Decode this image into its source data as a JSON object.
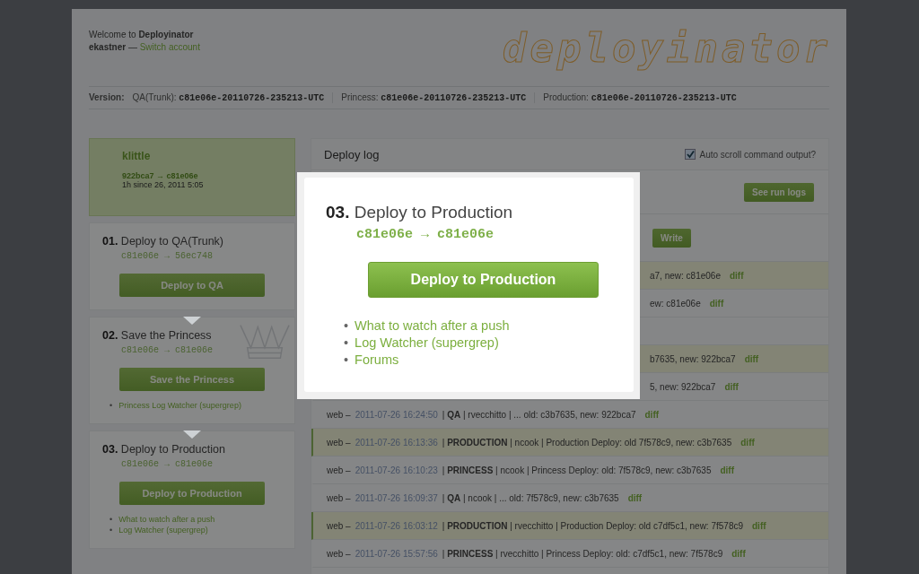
{
  "header": {
    "welcome_prefix": "Welcome to ",
    "app_name": "Deployinator",
    "user": "ekastner",
    "separator": " — ",
    "switch_link": "Switch account",
    "logo": "deployinator"
  },
  "versions": {
    "label": "Version:",
    "items": [
      {
        "env": "QA(Trunk):",
        "value": "c81e06e-20110726-235213-UTC"
      },
      {
        "env": "Princess:",
        "value": "c81e06e-20110726-235213-UTC"
      },
      {
        "env": "Production:",
        "value": "c81e06e-20110726-235213-UTC"
      }
    ]
  },
  "current_deploy": {
    "user": "klittle",
    "revs": "922bca7 → c81e06e",
    "since": "1h since 26, 2011 5:05"
  },
  "steps": [
    {
      "number": "01.",
      "title": "Deploy to QA(Trunk)",
      "revs": "c81e06e → 56ec748",
      "button": "Deploy to QA"
    },
    {
      "number": "02.",
      "title": "Save the Princess",
      "revs": "c81e06e → c81e06e",
      "button": "Save the Princess",
      "links": [
        {
          "bullet": "•",
          "text": "Princess Log Watcher (supergrep)"
        }
      ]
    },
    {
      "number": "03.",
      "title": "Deploy to Production",
      "revs": "c81e06e → c81e06e",
      "button": "Deploy to Production",
      "links": [
        {
          "bullet": "•",
          "text": "What to watch after a push"
        },
        {
          "bullet": "•",
          "text": "Log Watcher (supergrep)"
        }
      ]
    }
  ],
  "log": {
    "title": "Deploy log",
    "auto_scroll": {
      "label": "Auto scroll command output?",
      "checked": true
    },
    "run_logs_button": "See run logs",
    "write_button": "Write",
    "rows": [
      {
        "kind": "covered",
        "tail": "a7, new: c81e06e",
        "diff": "diff",
        "highlighted": true
      },
      {
        "kind": "covered",
        "tail": "ew: c81e06e",
        "diff": "diff",
        "highlighted": false
      },
      {
        "kind": "covered",
        "highlighted": false
      },
      {
        "kind": "covered",
        "tail": "b7635, new: 922bca7",
        "diff": "diff",
        "highlighted": true
      },
      {
        "kind": "covered",
        "tail": "5, new: 922bca7",
        "diff": "diff",
        "highlighted": false
      },
      {
        "kind": "entry",
        "source": "web –",
        "time": "2011-07-26 16:24:50",
        "text": "| **QA** | rvecchitto | ... old: c3b7635, new: 922bca7",
        "diff": "diff",
        "highlighted": false
      },
      {
        "kind": "entry",
        "source": "web –",
        "time": "2011-07-26 16:13:36",
        "text": "| **PRODUCTION** | ncook | Production Deploy: old 7f578c9, new: c3b7635",
        "diff": "diff",
        "highlighted": true
      },
      {
        "kind": "entry",
        "source": "web –",
        "time": "2011-07-26 16:10:23",
        "text": "| **PRINCESS** | ncook | Princess Deploy: old: 7f578c9, new: c3b7635",
        "diff": "diff",
        "highlighted": false
      },
      {
        "kind": "entry",
        "source": "web –",
        "time": "2011-07-26 16:09:37",
        "text": "| **QA** | ncook | ... old: 7f578c9, new: c3b7635",
        "diff": "diff",
        "highlighted": false
      },
      {
        "kind": "entry",
        "source": "web –",
        "time": "2011-07-26 16:03:12",
        "text": "| **PRODUCTION** | rvecchitto | Production Deploy: old c7df5c1, new: 7f578c9",
        "diff": "diff",
        "highlighted": true
      },
      {
        "kind": "entry",
        "source": "web –",
        "time": "2011-07-26 15:57:56",
        "text": "| **PRINCESS** | rvecchitto | Princess Deploy: old: c7df5c1, new: 7f578c9",
        "diff": "diff",
        "highlighted": false
      }
    ]
  },
  "modal": {
    "number": "03.",
    "title": "Deploy to Production",
    "revs": "c81e06e → c81e06e",
    "button": "Deploy to Production",
    "links": [
      {
        "bullet": "•",
        "text": "What to watch after a push"
      },
      {
        "bullet": "•",
        "text": "Log Watcher (supergrep)"
      },
      {
        "bullet": "•",
        "text": "Forums"
      }
    ]
  }
}
